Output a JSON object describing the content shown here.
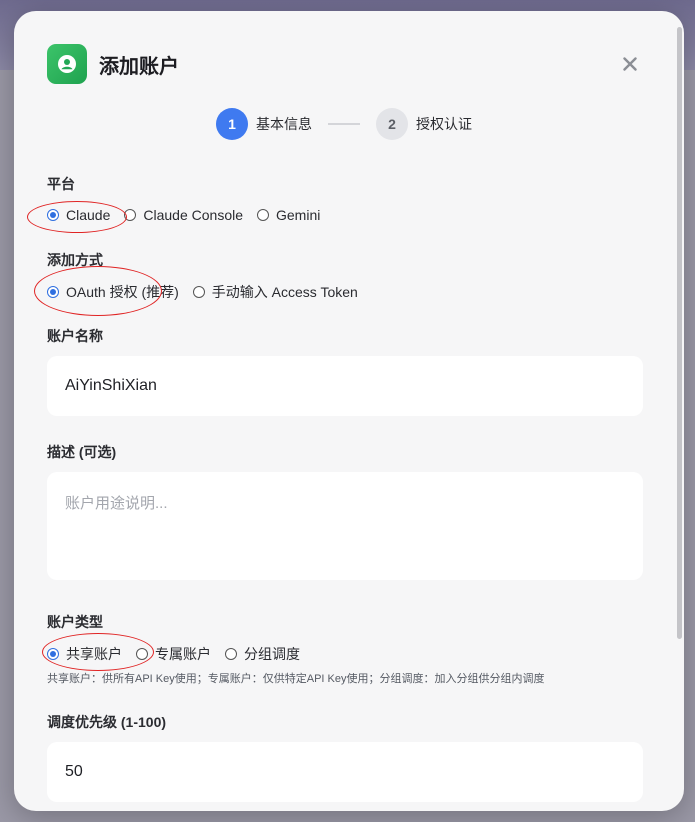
{
  "dialog": {
    "title": "添加账户",
    "header_icon": "user-icon",
    "close_icon": "close-icon",
    "accent_color": "#3f7af0",
    "brand_color": "#22a855"
  },
  "steps": [
    {
      "number": "1",
      "label": "基本信息",
      "active": true
    },
    {
      "number": "2",
      "label": "授权认证",
      "active": false
    }
  ],
  "platform": {
    "label": "平台",
    "options": [
      "Claude",
      "Claude Console",
      "Gemini"
    ],
    "selected": "Claude"
  },
  "add_method": {
    "label": "添加方式",
    "options": [
      "OAuth 授权 (推荐)",
      "手动输入 Access Token"
    ],
    "selected": "OAuth 授权 (推荐)"
  },
  "account_name": {
    "label": "账户名称",
    "value": "AiYinShiXian"
  },
  "description": {
    "label": "描述 (可选)",
    "placeholder": "账户用途说明..."
  },
  "account_type": {
    "label": "账户类型",
    "options": [
      "共享账户",
      "专属账户",
      "分组调度"
    ],
    "selected": "共享账户",
    "hint": "共享账户：供所有API Key使用；专属账户：仅供特定API Key使用；分组调度：加入分组供分组内调度"
  },
  "priority": {
    "label": "调度优先级 (1-100)",
    "value": "50"
  }
}
